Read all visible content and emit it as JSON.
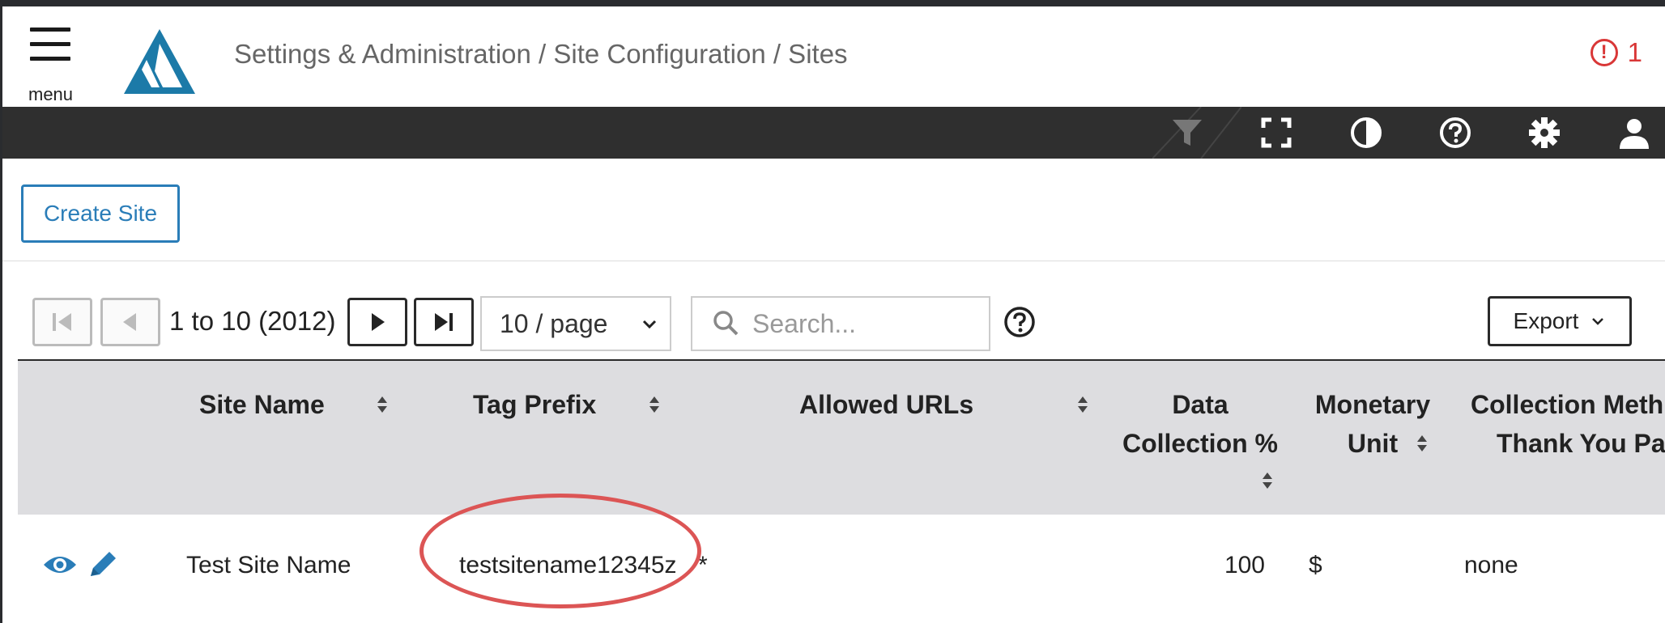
{
  "header": {
    "menu_label": "menu",
    "breadcrumb": "Settings & Administration / Site Configuration / Sites",
    "alert_count": "1",
    "alert_icon": "exclamation-circle-icon",
    "accent_color": "#d93737"
  },
  "toolbar": {
    "icons": [
      "filter-icon",
      "fullscreen-icon",
      "contrast-icon",
      "help-icon",
      "gear-icon",
      "user-icon"
    ]
  },
  "actions": {
    "create_site_label": "Create Site"
  },
  "pager": {
    "range_text": "1 to 10 (2012)",
    "page_size": "10 / page",
    "search_placeholder": "Search...",
    "export_label": "Export"
  },
  "table": {
    "columns": {
      "site_name": "Site Name",
      "tag_prefix": "Tag Prefix",
      "allowed_urls": "Allowed URLs",
      "data_collection_line1": "Data",
      "data_collection_line2": "Collection %",
      "monetary_line1": "Monetary",
      "monetary_line2": "Unit",
      "collection_line1": "Collection Meth",
      "collection_line2": "Thank You Pa"
    },
    "rows": [
      {
        "site_name": "Test Site Name",
        "tag_prefix": "testsitename12345z",
        "allowed_urls": "*",
        "data_collection": "100",
        "monetary_unit": "$",
        "collection_method": "none"
      }
    ]
  }
}
